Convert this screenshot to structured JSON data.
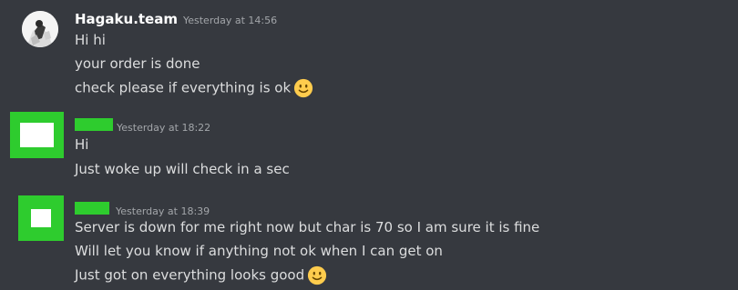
{
  "theme": {
    "background": "#36393f",
    "text": "#dcddde",
    "username": "#ffffff",
    "timestamp": "#a3a6aa",
    "redaction": "#2ecc2e"
  },
  "messages": [
    {
      "author": "Hagaku.team",
      "timestamp": "Yesterday at 14:56",
      "avatar": "photo-avatar",
      "lines": [
        "Hi hi",
        "your order is done",
        "check please if everything is ok"
      ],
      "emoji": "slightly-smiling-face-icon"
    },
    {
      "author": "",
      "author_redacted": true,
      "timestamp": "Yesterday at 18:22",
      "avatar": "redacted-avatar",
      "lines": [
        "Hi",
        "Just woke up will check in a sec"
      ]
    },
    {
      "author": "",
      "author_redacted": true,
      "timestamp": "Yesterday at 18:39",
      "avatar": "redacted-avatar",
      "lines": [
        "Server is down for me right now but char is 70 so I am sure it is fine",
        "Will let you know if anything not ok when I can get on",
        "Just got on everything looks good"
      ],
      "emoji": "slightly-smiling-face-icon"
    }
  ]
}
